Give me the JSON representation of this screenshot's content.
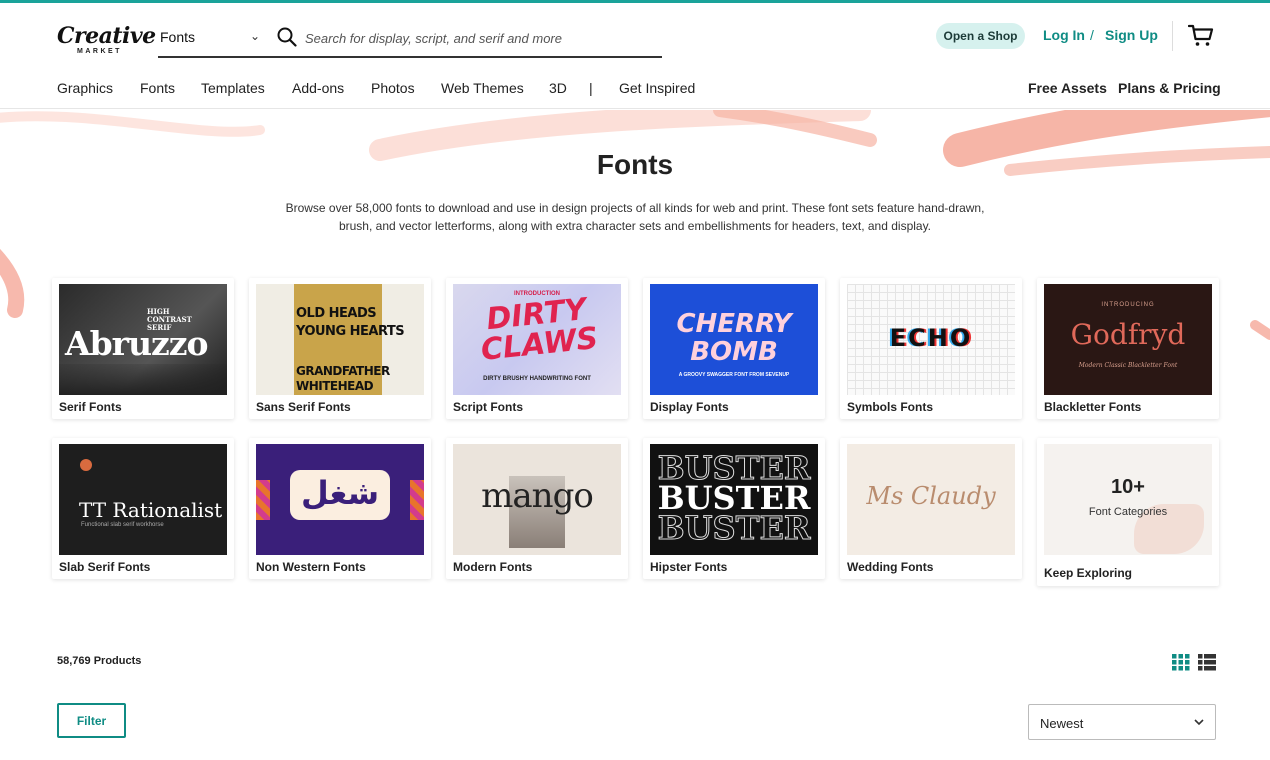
{
  "header": {
    "logo_main": "Creative",
    "logo_sub": "MARKET",
    "search_category": "Fonts",
    "search_placeholder": "Search for display, script, and serif and more",
    "open_shop": "Open a Shop",
    "login": "Log In",
    "slash": "/",
    "signup": "Sign Up"
  },
  "nav": {
    "items": [
      "Graphics",
      "Fonts",
      "Templates",
      "Add-ons",
      "Photos",
      "Web Themes",
      "3D",
      "|",
      "Get Inspired"
    ],
    "right": [
      "Free Assets",
      "Plans & Pricing"
    ]
  },
  "hero": {
    "title": "Fonts",
    "description": "Browse over 58,000 fonts to download and use in design projects of all kinds for web and print. These font sets feature hand-drawn, brush, and vector letterforms, along with extra character sets and embellishments for headers, text, and display."
  },
  "categories": [
    {
      "label": "Serif Fonts",
      "thumb_text": "Abruzzo",
      "thumb_sub": "HIGH CONTRAST SERIF"
    },
    {
      "label": "Sans Serif Fonts",
      "thumb_text": "OLD HEADS",
      "thumb_sub": "YOUNG HEARTS",
      "thumb_sub2": "GRANDFATHER",
      "thumb_sub3": "WHITEHEAD"
    },
    {
      "label": "Script Fonts",
      "thumb_text": "DIRTY CLAWS",
      "thumb_sub": "INTRODUCTION",
      "thumb_sub2": "DIRTY BRUSHY HANDWRITING FONT"
    },
    {
      "label": "Display Fonts",
      "thumb_text": "CHERRY BOMB",
      "thumb_sub": "A GROOVY SWAGGER FONT FROM SEVENUP"
    },
    {
      "label": "Symbols Fonts",
      "thumb_text": "ECHO"
    },
    {
      "label": "Blackletter Fonts",
      "thumb_text": "Godfryd",
      "thumb_sub": "INTRODUCING",
      "thumb_sub2": "Modern Classic Blackletter Font"
    },
    {
      "label": "Slab Serif Fonts",
      "thumb_text": "TT Rationalist",
      "thumb_sub": "Functional slab serif workhorse"
    },
    {
      "label": "Non Western Fonts",
      "thumb_text": "شغل"
    },
    {
      "label": "Modern Fonts",
      "thumb_text": "mango"
    },
    {
      "label": "Hipster Fonts",
      "thumb_text": "BUSTER"
    },
    {
      "label": "Wedding Fonts",
      "thumb_text": "Ms Claudy"
    },
    {
      "label": "Keep Exploring",
      "thumb_text": "10+",
      "thumb_sub": "Font Categories"
    }
  ],
  "products": {
    "count": "58,769 Products",
    "filter": "Filter",
    "sort": "Newest"
  },
  "colors": {
    "accent": "#0f8c84",
    "shop_bg": "#d6f1ee",
    "brush": "#f7b3a4"
  }
}
